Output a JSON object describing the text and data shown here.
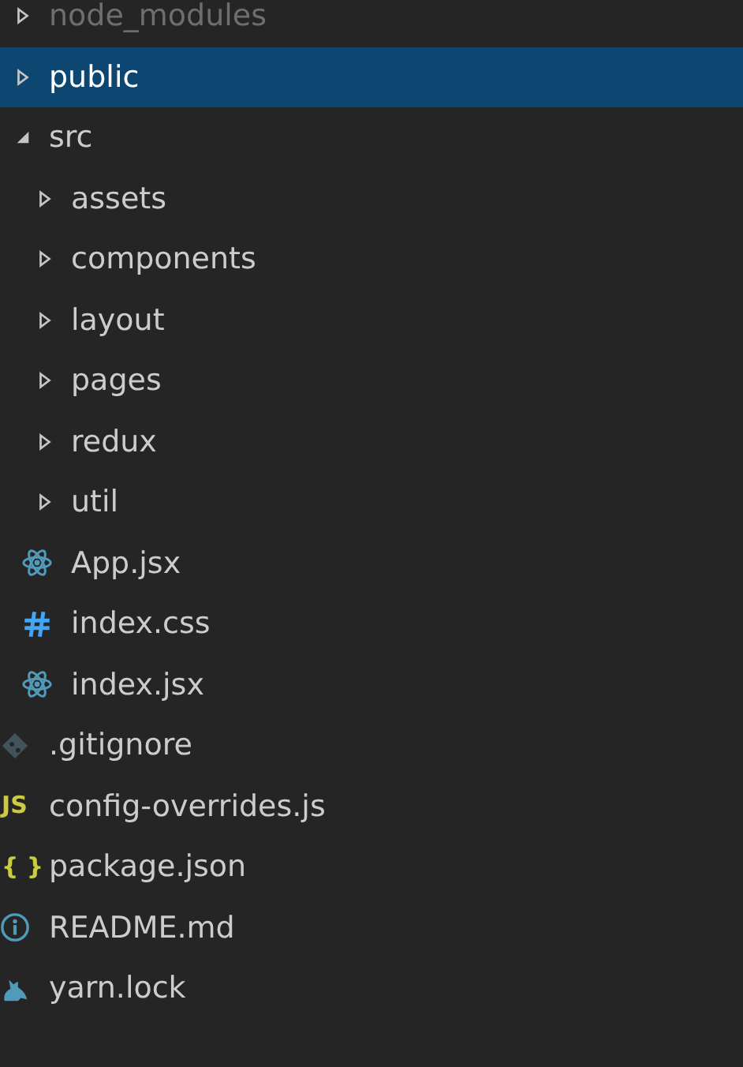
{
  "explorer": {
    "items": [
      {
        "kind": "folder",
        "name": "node_modules",
        "expanded": false,
        "selected": false,
        "ignored": true
      },
      {
        "kind": "folder",
        "name": "public",
        "expanded": false,
        "selected": true,
        "ignored": false
      },
      {
        "kind": "folder",
        "name": "src",
        "expanded": true,
        "selected": false,
        "ignored": false,
        "children": [
          {
            "kind": "folder",
            "name": "assets",
            "expanded": false,
            "selected": false,
            "ignored": false
          },
          {
            "kind": "folder",
            "name": "components",
            "expanded": false,
            "selected": false,
            "ignored": false
          },
          {
            "kind": "folder",
            "name": "layout",
            "expanded": false,
            "selected": false,
            "ignored": false
          },
          {
            "kind": "folder",
            "name": "pages",
            "expanded": false,
            "selected": false,
            "ignored": false
          },
          {
            "kind": "folder",
            "name": "redux",
            "expanded": false,
            "selected": false,
            "ignored": false
          },
          {
            "kind": "folder",
            "name": "util",
            "expanded": false,
            "selected": false,
            "ignored": false
          },
          {
            "kind": "react",
            "name": "App.jsx",
            "selected": false,
            "ignored": false
          },
          {
            "kind": "css",
            "name": "index.css",
            "selected": false,
            "ignored": false
          },
          {
            "kind": "react",
            "name": "index.jsx",
            "selected": false,
            "ignored": false
          }
        ]
      },
      {
        "kind": "git",
        "name": ".gitignore",
        "selected": false,
        "ignored": false
      },
      {
        "kind": "badge",
        "badge": "JS",
        "color": "#cbcb41",
        "name": "config-overrides.js",
        "selected": false,
        "ignored": false
      },
      {
        "kind": "badge",
        "badge": "{ }",
        "color": "#cbcb41",
        "name": "package.json",
        "selected": false,
        "ignored": false
      },
      {
        "kind": "info",
        "name": "README.md",
        "selected": false,
        "ignored": false
      },
      {
        "kind": "yarn",
        "name": "yarn.lock",
        "selected": false,
        "ignored": false
      }
    ]
  }
}
